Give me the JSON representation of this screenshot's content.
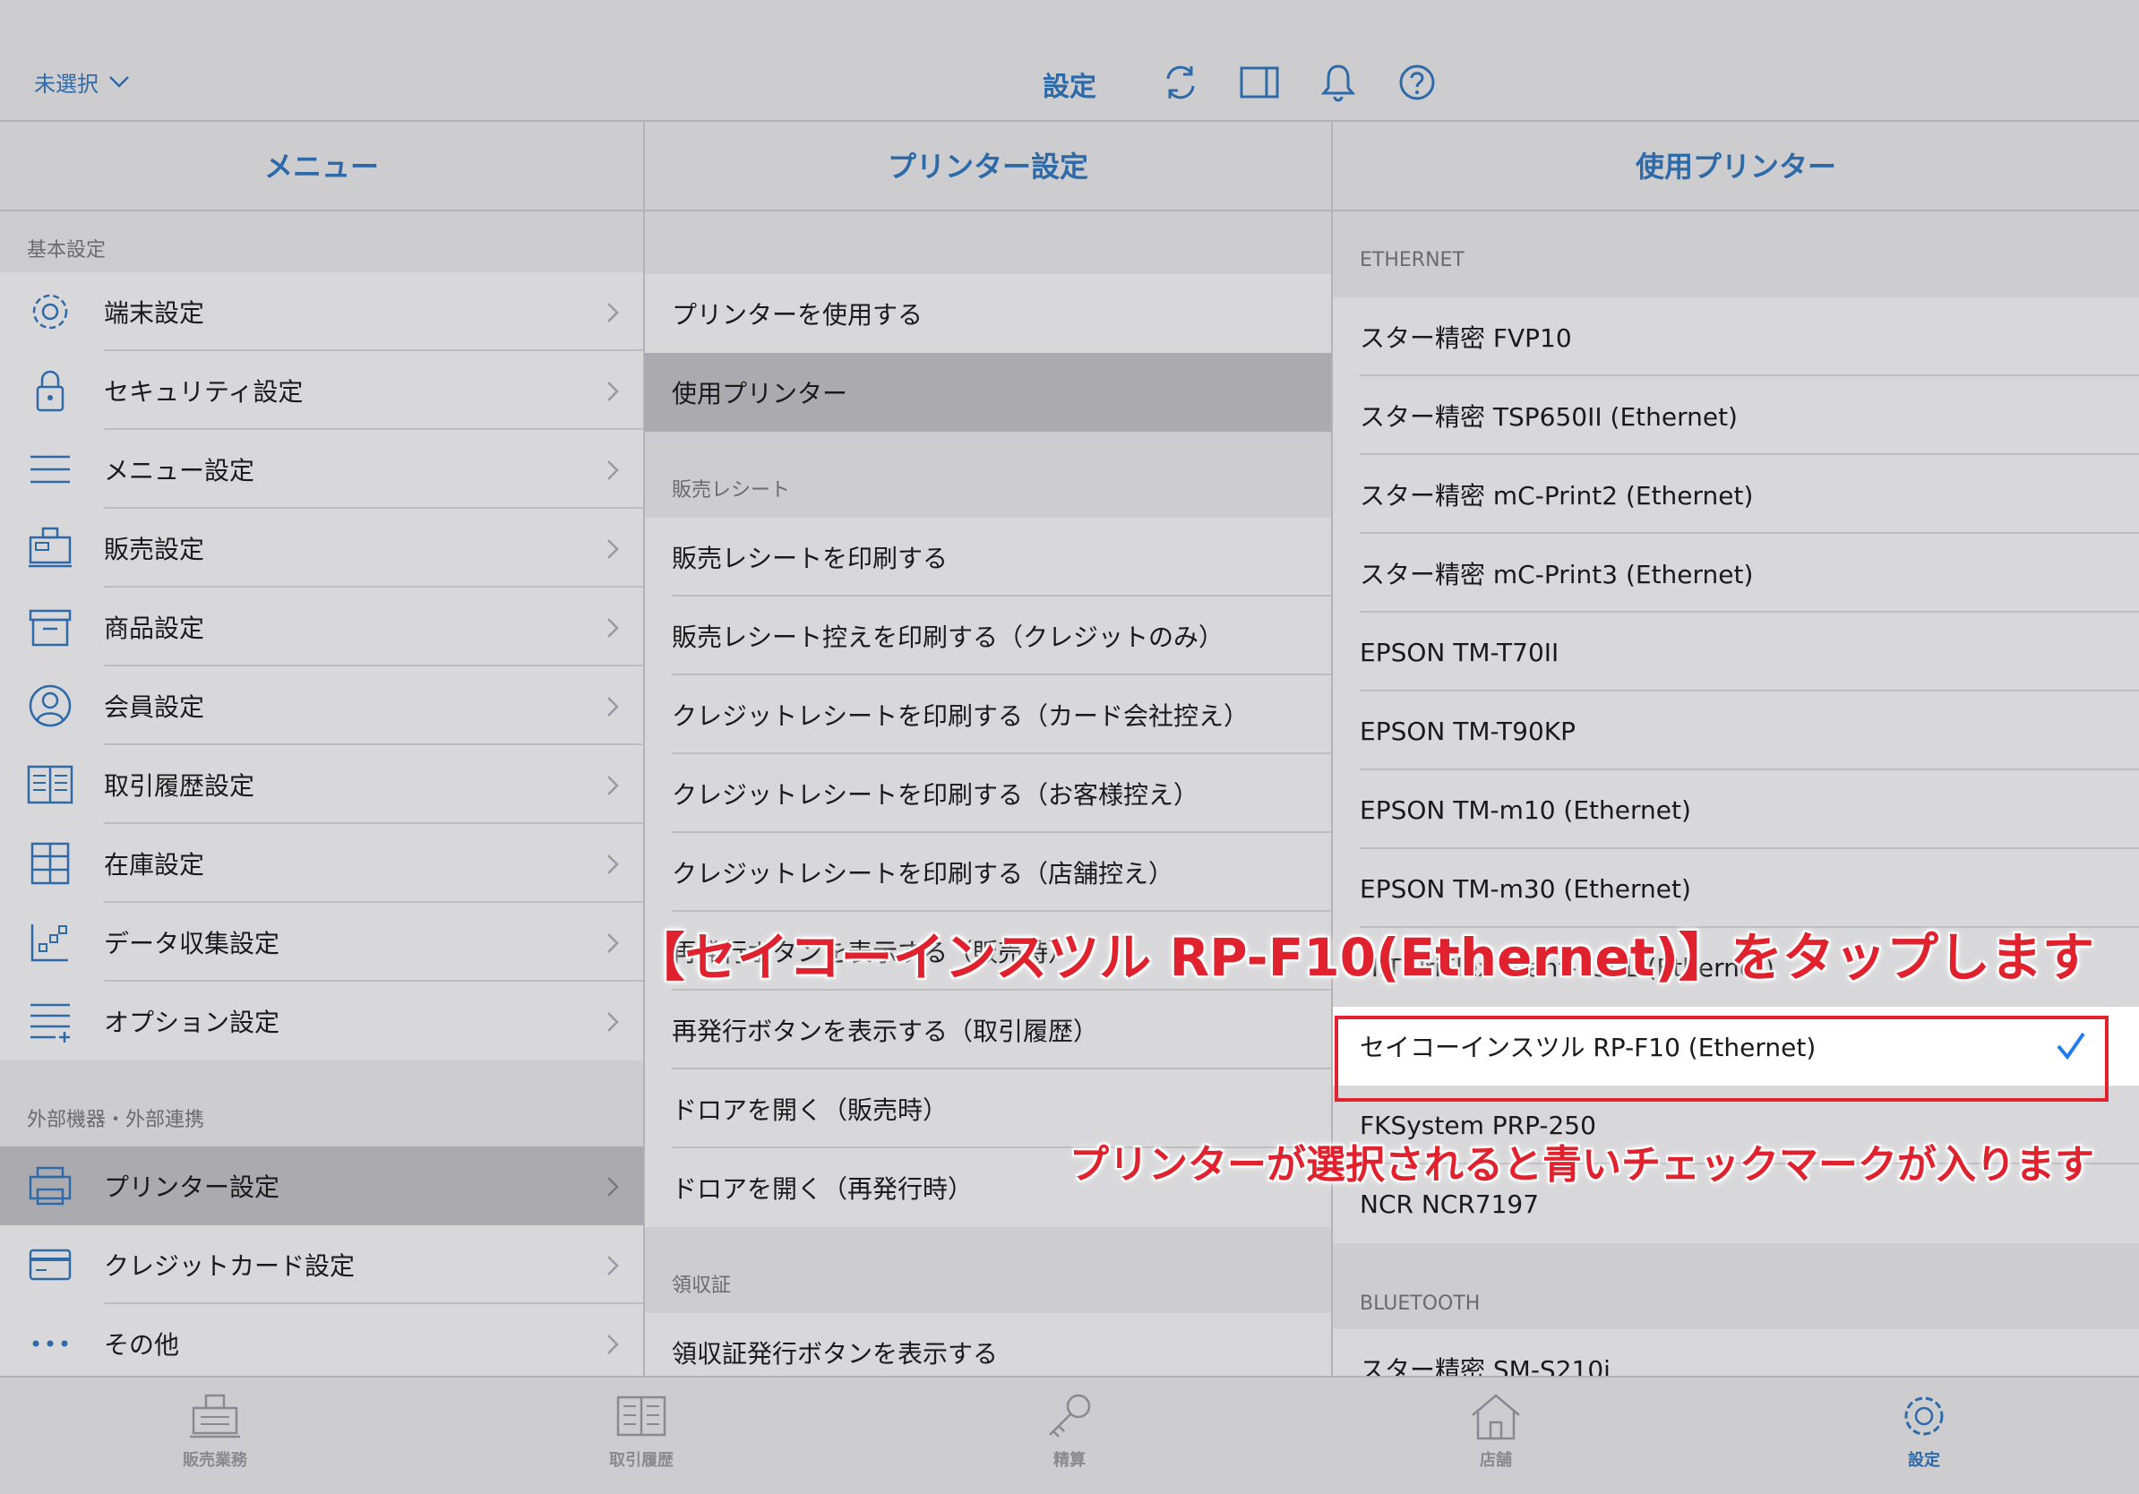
{
  "topbar": {
    "unselected_label": "未選択",
    "title": "設定",
    "icons": [
      "refresh-icon",
      "split-view-icon",
      "bell-icon",
      "help-icon"
    ]
  },
  "menu": {
    "header": "メニュー",
    "section_basic": "基本設定",
    "basic_items": [
      {
        "label": "端末設定",
        "icon": "gear-icon"
      },
      {
        "label": "セキュリティ設定",
        "icon": "lock-icon"
      },
      {
        "label": "メニュー設定",
        "icon": "list-icon"
      },
      {
        "label": "販売設定",
        "icon": "register-icon"
      },
      {
        "label": "商品設定",
        "icon": "box-icon"
      },
      {
        "label": "会員設定",
        "icon": "person-icon"
      },
      {
        "label": "取引履歴設定",
        "icon": "book-icon"
      },
      {
        "label": "在庫設定",
        "icon": "cabinet-icon"
      },
      {
        "label": "データ収集設定",
        "icon": "data-icon"
      },
      {
        "label": "オプション設定",
        "icon": "list-add-icon"
      }
    ],
    "section_external": "外部機器・外部連携",
    "external_items": [
      {
        "label": "プリンター設定",
        "icon": "printer-icon"
      },
      {
        "label": "クレジットカード設定",
        "icon": "credit-card-icon"
      },
      {
        "label": "その他",
        "icon": "more-icon"
      }
    ]
  },
  "printer_settings": {
    "header": "プリンター設定",
    "top_items": [
      "プリンターを使用する",
      "使用プリンター"
    ],
    "section_receipt": "販売レシート",
    "receipt_items": [
      "販売レシートを印刷する",
      "販売レシート控えを印刷する（クレジットのみ）",
      "クレジットレシートを印刷する（カード会社控え）",
      "クレジットレシートを印刷する（お客様控え）",
      "クレジットレシートを印刷する（店舗控え）",
      "再発行ボタンを表示する（販売時）",
      "再発行ボタンを表示する（取引履歴）",
      "ドロアを開く（販売時）",
      "ドロアを開く（再発行時）"
    ],
    "section_invoice": "領収証",
    "invoice_items": [
      "領収証発行ボタンを表示する"
    ]
  },
  "printers": {
    "header": "使用プリンター",
    "section_ethernet": "ETHERNET",
    "ethernet_items": [
      "スター精密 FVP10",
      "スター精密 TSP650II (Ethernet)",
      "スター精密 mC-Print2 (Ethernet)",
      "スター精密 mC-Print3 (Ethernet)",
      "EPSON TM-T70II",
      "EPSON TM-T90KP",
      "EPSON TM-m10 (Ethernet)",
      "EPSON TM-m30 (Ethernet)",
      "HIT PriFlex Giant-150L (Ethernet)",
      "セイコーインスツル RP-F10 (Ethernet)",
      "FKSystem PRP-250",
      "NCR NCR7197"
    ],
    "selected_index": 9,
    "section_bluetooth": "BLUETOOTH",
    "bluetooth_items": [
      "スター精密 SM-S210i"
    ]
  },
  "annotations": {
    "tap_instruction": "【セイコーインスツル RP-F10(Ethernet)】をタップします",
    "check_note": "プリンターが選択されると青いチェックマークが入ります"
  },
  "tabbar": {
    "tabs": [
      {
        "label": "販売業務",
        "icon": "register-icon"
      },
      {
        "label": "取引履歴",
        "icon": "book-icon"
      },
      {
        "label": "精算",
        "icon": "key-icon"
      },
      {
        "label": "店舗",
        "icon": "home-icon"
      },
      {
        "label": "設定",
        "icon": "gear-icon"
      }
    ],
    "active_index": 4
  },
  "colors": {
    "accent": "#2e6aa8",
    "check": "#1e7cf0",
    "annotation_red": "#e0222e"
  }
}
